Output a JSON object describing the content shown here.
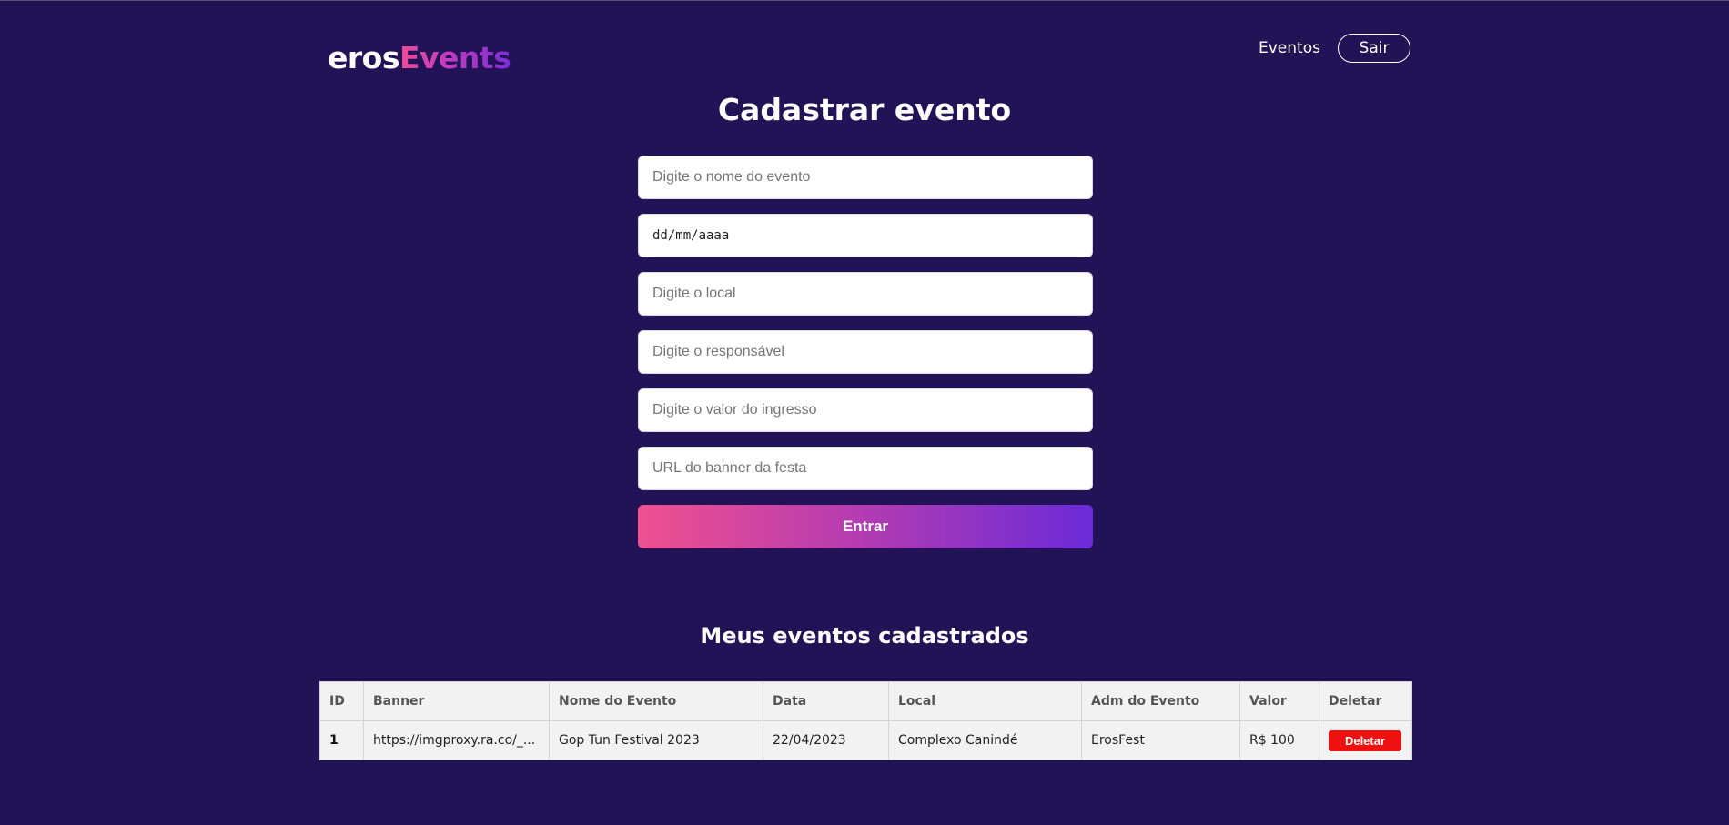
{
  "header": {
    "logo_part1": "eros",
    "logo_part2": "Events",
    "nav_events": "Eventos",
    "logout_label": "Sair"
  },
  "form": {
    "title": "Cadastrar evento",
    "name_placeholder": "Digite o nome do evento",
    "date_placeholder": "dd/mm/aaaa",
    "location_placeholder": "Digite o local",
    "responsible_placeholder": "Digite o responsável",
    "price_placeholder": "Digite o valor do ingresso",
    "banner_placeholder": "URL do banner da festa",
    "submit_label": "Entrar"
  },
  "events": {
    "title": "Meus eventos cadastrados",
    "columns": [
      "ID",
      "Banner",
      "Nome do Evento",
      "Data",
      "Local",
      "Adm do Evento",
      "Valor",
      "Deletar"
    ],
    "rows": [
      {
        "id": "1",
        "banner": "https://imgproxy.ra.co/_...",
        "name": "Gop Tun Festival 2023",
        "date": "22/04/2023",
        "location": "Complexo Canindé",
        "admin": "ErosFest",
        "price": "R$ 100",
        "delete_label": "Deletar"
      }
    ]
  },
  "colors": {
    "background": "#211356",
    "accent_start": "#f0508f",
    "accent_end": "#6a2bd8",
    "delete": "#ef1010"
  }
}
